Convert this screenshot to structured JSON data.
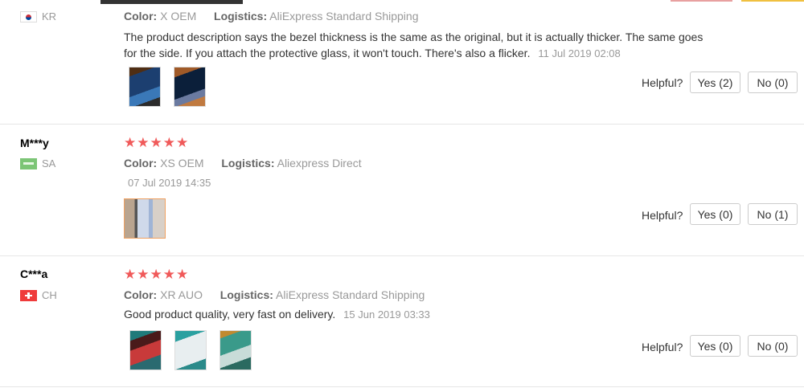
{
  "helpful_label": "Helpful?",
  "reviews": [
    {
      "user": "",
      "country": "KR",
      "stars": "★★★★★",
      "color_label": "Color:",
      "color": "X OEM",
      "logistics_label": "Logistics:",
      "logistics": "AliExpress Standard Shipping",
      "text": "The product description says the bezel thickness is the same as the original, but it is actually thicker. The same goes for the side. If you attach the protective glass, it won't touch. There's also a flicker.",
      "date": "11 Jul 2019 02:08",
      "yes": "Yes (2)",
      "no": "No (0)"
    },
    {
      "user": "M***y",
      "country": "SA",
      "stars": "★★★★★",
      "color_label": "Color:",
      "color": "XS OEM",
      "logistics_label": "Logistics:",
      "logistics": "Aliexpress Direct",
      "text": "",
      "date": "07 Jul 2019 14:35",
      "yes": "Yes (0)",
      "no": "No (1)"
    },
    {
      "user": "C***a",
      "country": "CH",
      "stars": "★★★★★",
      "color_label": "Color:",
      "color": "XR AUO",
      "logistics_label": "Logistics:",
      "logistics": "AliExpress Standard Shipping",
      "text": "Good product quality, very fast on delivery.",
      "date": "15 Jun 2019 03:33",
      "yes": "Yes (0)",
      "no": "No (0)"
    }
  ],
  "colors": {
    "star": "#f05a5a",
    "accent_border": "#f0a060"
  }
}
